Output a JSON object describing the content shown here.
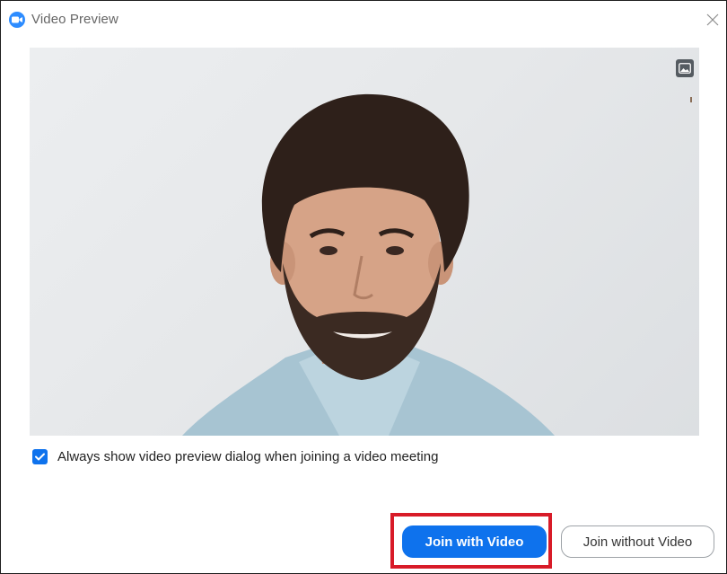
{
  "window": {
    "title": "Video Preview"
  },
  "options": {
    "always_show_preview_label": "Always show video preview dialog when joining a video meeting",
    "always_show_preview_checked": true
  },
  "actions": {
    "join_with_video_label": "Join with Video",
    "join_without_video_label": "Join without Video"
  },
  "icons": {
    "app": "zoom-camera-icon",
    "close": "close-icon",
    "background": "virtual-background-icon",
    "check": "checkmark-icon"
  },
  "colors": {
    "accent": "#0e72ed",
    "highlight": "#d81b28",
    "app_icon": "#2d8cff"
  }
}
